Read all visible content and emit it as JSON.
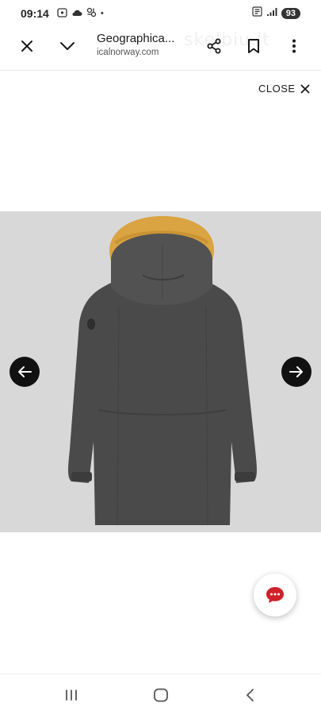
{
  "status_bar": {
    "time": "09:14",
    "battery": "93",
    "dot": "•"
  },
  "browser": {
    "title": "Geographica...",
    "url": "icalnorway.com",
    "watermark": "skelbiu.lt"
  },
  "lightbox": {
    "close_label": "CLOSE"
  },
  "icons": {
    "close_tab": "close-icon",
    "collapse": "chevron-down-icon",
    "share": "share-icon",
    "bookmark": "bookmark-icon",
    "more": "more-vertical-icon",
    "prev": "arrow-left-icon",
    "next": "arrow-right-icon",
    "chat": "chat-icon",
    "recents": "recents-icon",
    "home": "home-icon",
    "back": "back-icon"
  },
  "colors": {
    "image_background": "#d8d8d8",
    "jacket": "#4a4a4a",
    "fur": "#d9a441",
    "chat_accent": "#d0202a",
    "arrow_button": "#111111"
  }
}
